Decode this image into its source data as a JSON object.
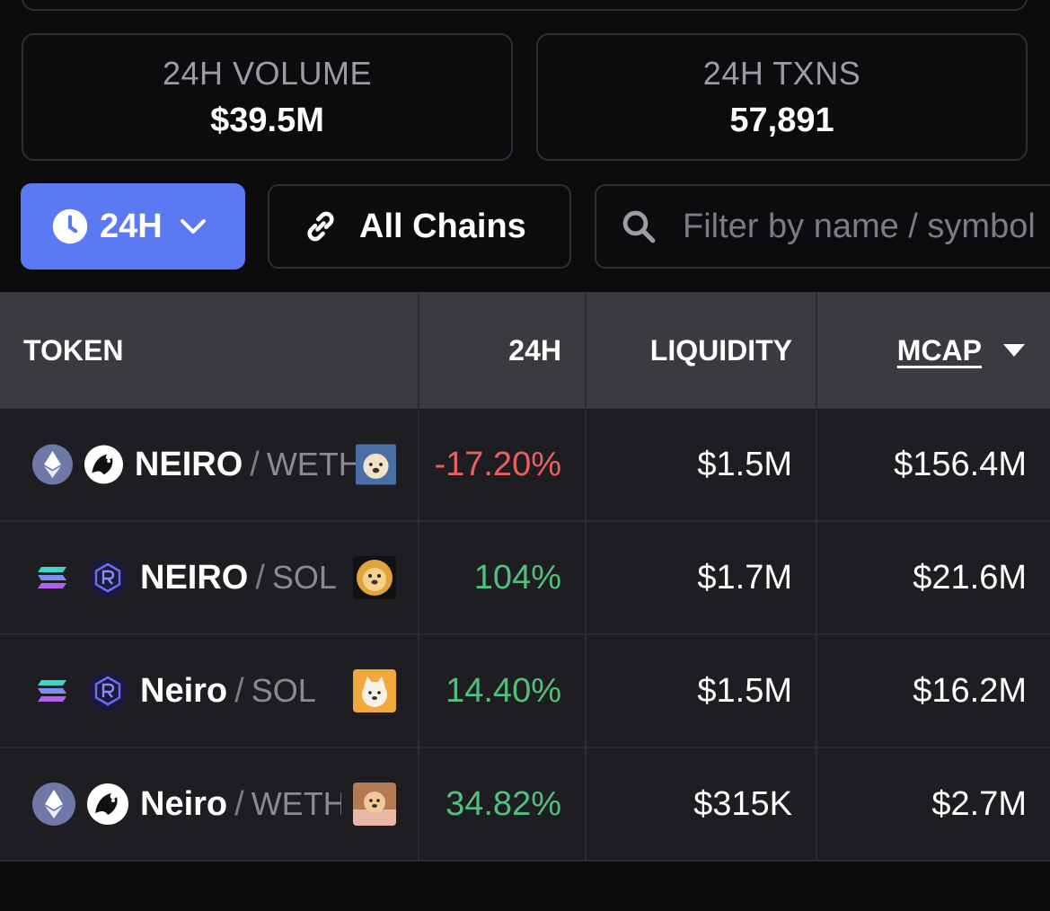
{
  "stats": {
    "volume_label": "24H VOLUME",
    "volume_value": "$39.5M",
    "txns_label": "24H TXNS",
    "txns_value": "57,891"
  },
  "filters": {
    "time_label": "24H",
    "chains_label": "All Chains",
    "search_placeholder": "Filter by name / symbol",
    "accent": "#5a79f2"
  },
  "table": {
    "headers": {
      "token": "TOKEN",
      "change": "24H",
      "liquidity": "LIQUIDITY",
      "mcap": "MCAP"
    },
    "rows": [
      {
        "chain_icon": "ethereum-icon",
        "dex_icon": "uniswap-icon",
        "symbol": "NEIRO",
        "quote": "WETH",
        "change": "-17.20%",
        "liquidity": "$1.5M",
        "mcap": "$156.4M"
      },
      {
        "chain_icon": "solana-icon",
        "dex_icon": "raydium-icon",
        "symbol": "NEIRO",
        "quote": "SOL",
        "change": "104%",
        "liquidity": "$1.7M",
        "mcap": "$21.6M"
      },
      {
        "chain_icon": "solana-icon",
        "dex_icon": "raydium-icon",
        "symbol": "Neiro",
        "quote": "SOL",
        "change": "14.40%",
        "liquidity": "$1.5M",
        "mcap": "$16.2M"
      },
      {
        "chain_icon": "ethereum-icon",
        "dex_icon": "uniswap-icon",
        "symbol": "Neiro",
        "quote": "WETH",
        "change": "34.82%",
        "liquidity": "$315K",
        "mcap": "$2.7M"
      }
    ]
  },
  "colors": {
    "positive": "#52c07b",
    "negative": "#e8605f"
  }
}
